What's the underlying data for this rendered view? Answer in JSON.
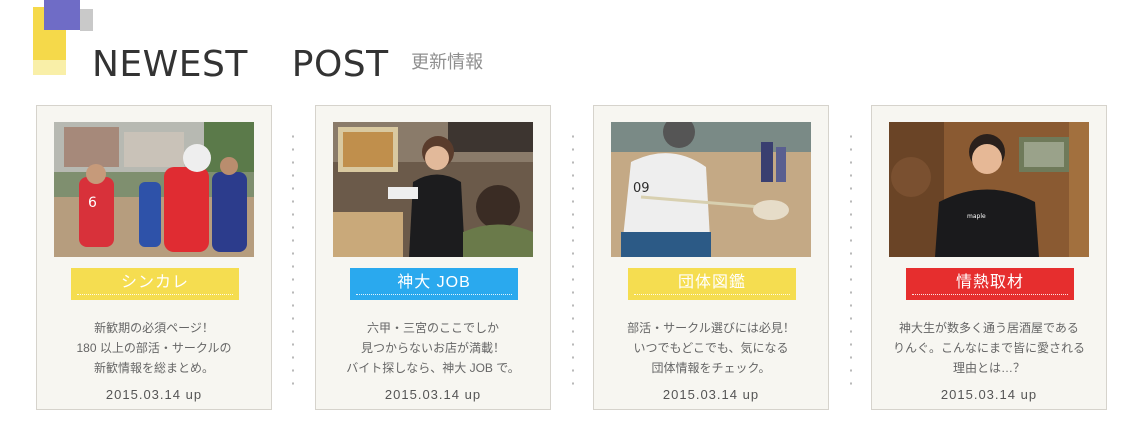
{
  "section": {
    "title": "NEWEST  POST",
    "subtitle": "更新情報"
  },
  "colors": {
    "shinkare": "#f5dd50",
    "job": "#2aa9ee",
    "dantai": "#f5dd50",
    "shuzai": "#e62e2e",
    "card_bg": "#f7f6f1"
  },
  "cards": [
    {
      "category": "シンカレ",
      "lines": [
        "新歓期の必須ページ！",
        "180 以上の部活・サークルの",
        "新歓情報を総まとめ。"
      ],
      "date": "2015.03.14 up",
      "photo": "american-football-players"
    },
    {
      "category": "神大 JOB",
      "lines": [
        "六甲・三宮のここでしか",
        "見つからないお店が満載！",
        "バイト探しなら、神大 JOB で。"
      ],
      "date": "2015.03.14 up",
      "photo": "restaurant-staff-taking-order"
    },
    {
      "category": "団体図鑑",
      "lines": [
        "部活・サークル選びには必見！",
        "いつでもどこでも、気になる",
        "団体情報をチェック。"
      ],
      "date": "2015.03.14 up",
      "photo": "lacrosse-player"
    },
    {
      "category": "情熱取材",
      "lines": [
        "神大生が数多く通う居酒屋である",
        "りんぐ。こんなにまで皆に愛される",
        "理由とは…？"
      ],
      "date": "2015.03.14 up",
      "photo": "man-in-black-sweater"
    }
  ]
}
